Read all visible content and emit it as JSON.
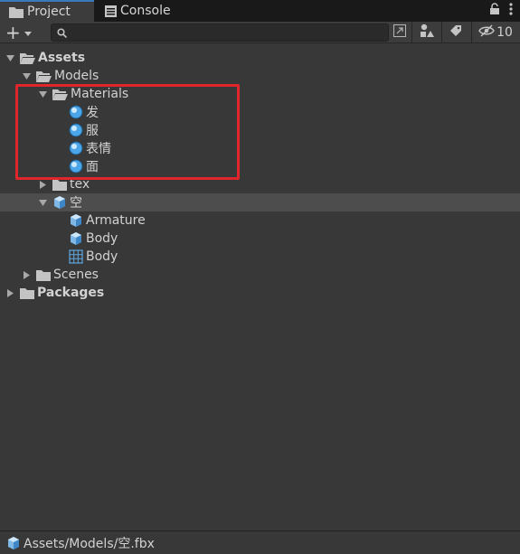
{
  "tabs": {
    "project_label": "Project",
    "console_label": "Console"
  },
  "toolbar": {
    "add_symbol": "+",
    "search_placeholder": "",
    "hidden_count": "10"
  },
  "tree": {
    "assets": "Assets",
    "models": "Models",
    "materials": "Materials",
    "material_items": [
      "发",
      "服",
      "表情",
      "面"
    ],
    "tex": "tex",
    "model_file": "空",
    "model_children": [
      "Armature",
      "Body",
      "Body"
    ],
    "scenes": "Scenes",
    "packages": "Packages"
  },
  "status": {
    "path": "Assets/Models/空.fbx"
  },
  "colors": {
    "background": "#383838",
    "tabbar": "#191919",
    "highlight": "#e0262a",
    "selected_row": "#4d4d4d",
    "material_sphere": "#4aa6e8"
  }
}
